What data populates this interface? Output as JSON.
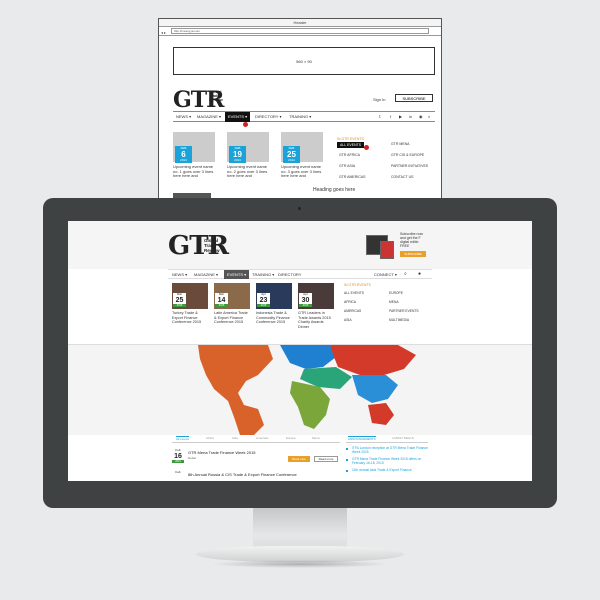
{
  "wireframe": {
    "window_title": "Header",
    "url": "http://mesuyya.com",
    "ad_label": "560 × 90",
    "logo": "GTR",
    "logo_sub": [
      "Global",
      "Trade",
      "Review"
    ],
    "sign_in": "Sign In",
    "subscribe": "SUBSCRIBE",
    "nav": [
      "NEWS ▾",
      "MAGAZINE ▾",
      "EVENTS ▾",
      "DIRECTORY ▾",
      "TRAINING ▾"
    ],
    "social_icons": [
      "twitter-icon",
      "facebook-icon",
      "youtube-icon",
      "linkedin-icon",
      "rss-icon",
      "search-icon"
    ],
    "cards": [
      {
        "month": "FEB",
        "day": "6",
        "year": "2014",
        "text": "Upcoming event name no. 1 goes over 3 lines here here and"
      },
      {
        "month": "FEB",
        "day": "19",
        "year": "2014",
        "text": "Upcoming event name no. 2 goes over 3 lines here here and"
      },
      {
        "month": "FEB",
        "day": "25",
        "year": "2014",
        "text": "Upcoming event name no. 3 goes over 3 lines here here and"
      }
    ],
    "menu_heading": "IN GTR EVENTS",
    "menu_left": [
      "ALL EVENTS",
      "GTR AFRICA",
      "GTR ASIA",
      "GTR AMERICAS"
    ],
    "menu_right": [
      "GTR MENA",
      "GTR CIS & EUROPE",
      "PARTNER INITIATIVES",
      "CONTACT US"
    ],
    "heading_goes_here": "Heading goes here"
  },
  "site": {
    "logo": "GTR",
    "logo_sub": [
      "Global",
      "Trade",
      "Review"
    ],
    "promo": {
      "text": [
        "Subscribe now",
        "and get the F",
        "digital editio",
        "FREE"
      ],
      "button": "SUBSCRIBE"
    },
    "nav": [
      "NEWS ▾",
      "MAGAZINE ▾",
      "EVENTS ▾",
      "TRAINING ▾",
      "DIRECTORY"
    ],
    "connect": "CONNECT ▾",
    "events": [
      {
        "month": "Mar",
        "day": "25",
        "year": "2015",
        "text": "Turkey Trade & Export Finance Conference 2015",
        "color": "#6a4a3a"
      },
      {
        "month": "Mar",
        "day": "14",
        "year": "2015",
        "text": "Latin America Trade & Export Finance Conference 2015",
        "color": "#8a6a4a"
      },
      {
        "month": "Apr",
        "day": "23",
        "year": "2015",
        "text": "Indonesia Trade & Commodity Finance Conference 2015",
        "color": "#2a3a5a"
      },
      {
        "month": "Apr",
        "day": "30",
        "year": "2015",
        "text": "GTR Leaders in Trade Awards 2015 Charity Awards Dinner",
        "color": "#4a3a3a"
      }
    ],
    "events_menu_heading": "IN GTR EVENTS",
    "events_menu_left": [
      "ALL EVENTS",
      "AFRICA",
      "AMERICAS",
      "ASIA"
    ],
    "events_menu_right": [
      "EUROPE",
      "MENA",
      "PARTNER EVENTS",
      "MULTIMEDIA"
    ],
    "map_colors": {
      "americas": "#d9622b",
      "europe_north": "#1f7fd0",
      "africa": "#7aa63a",
      "asia": "#2a8fd6",
      "mena": "#2aa57a",
      "russia": "#d33a2a",
      "oceania": "#d33a2a"
    },
    "tabs": [
      "All events",
      "Africa",
      "Asia",
      "Americas",
      "Europe",
      "Mena"
    ],
    "event_rows": [
      {
        "month": "Feb",
        "day": "16",
        "year": "2015",
        "title": "GTR Mena Trade Finance Week 2015",
        "location": "Dubai",
        "book": "Book now",
        "more": "Read more"
      },
      {
        "month": "Feb",
        "day": "",
        "year": "",
        "title": "8th Annual Russia & CIS Trade & Export Finance Conference",
        "location": "",
        "book": "",
        "more": ""
      }
    ],
    "announcements_tabs": [
      "ANNOUNCEMENTS",
      "LATEST DEALS"
    ],
    "announcements": [
      "ITFA London reception at GTR Mena Trade Finance Week 2015",
      "GTR Mena Trade Finance Week 2015 offers on February 16-18, 2015",
      "11th annual Asia Trade & Export Finance"
    ]
  }
}
